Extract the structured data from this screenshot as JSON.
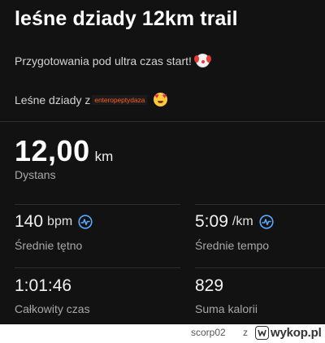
{
  "activity": {
    "title": "leśne dziady 12km trail",
    "description_line1": "Przygotowania pod ultra czas start!",
    "description_line2_prefix": "Leśne dziady z",
    "mention": "enteropeptydaza"
  },
  "distance": {
    "value": "12,00",
    "unit": "km",
    "label": "Dystans"
  },
  "stats": {
    "heart_rate": {
      "value": "140",
      "unit": "bpm",
      "label": "Średnie tętno",
      "icon": "trend-chart-icon"
    },
    "pace": {
      "value": "5:09",
      "unit": "/km",
      "label": "Średnie tempo",
      "icon": "trend-chart-icon"
    },
    "total_time": {
      "value": "1:01:46",
      "label": "Całkowity czas"
    },
    "calories": {
      "value": "829",
      "label": "Suma kalorii"
    }
  },
  "colors": {
    "background": "#121212",
    "accent_icon": "#5aa9ff",
    "mention": "#ff5a1f"
  },
  "watermark": {
    "author": "scorp02",
    "separator": "z",
    "site": "wykop.pl"
  }
}
